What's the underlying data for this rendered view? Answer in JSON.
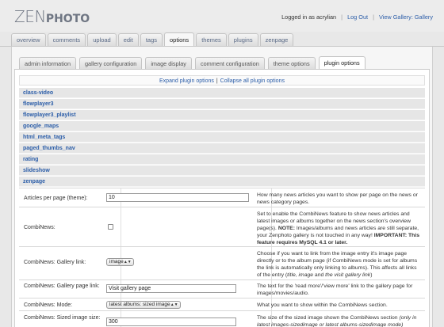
{
  "header": {
    "logo_part1": "ZEN",
    "logo_part2": "PHOTO",
    "logged_in": "Logged in as acrylian",
    "logout": "Log Out",
    "view_gallery": "View Gallery: Gallery"
  },
  "main_tabs": [
    "overview",
    "comments",
    "upload",
    "edit",
    "tags",
    "options",
    "themes",
    "plugins",
    "zenpage"
  ],
  "sub_tabs": [
    "admin information",
    "gallery configuration",
    "image display",
    "comment configuration",
    "theme options",
    "plugin options"
  ],
  "expand": {
    "expand_all": "Expand plugin options",
    "collapse_all": "Collapse all plugin options",
    "separator": "|"
  },
  "plugins": [
    "class-video",
    "flowplayer3",
    "flowplayer3_playlist",
    "google_maps",
    "html_meta_tags",
    "paged_thumbs_nav",
    "rating",
    "slideshow",
    "zenpage"
  ],
  "options": {
    "articles": {
      "label": "Articles per page (theme):",
      "value": "10",
      "desc": "How many news articles you want to show per page on the news or news category pages."
    },
    "combinews": {
      "label": "CombiNews:",
      "desc_a": "Set to enable the CombiNews feature to show news articles and latest images or albums together on the news section's overview page(s). ",
      "desc_note": "NOTE:",
      "desc_b": " Images/albums and news articles are still separate, your Zenphoto gallery is not touched in any way! ",
      "desc_important": "IMPORTANT: This feature requires MySQL 4.1 or later."
    },
    "gallery_link": {
      "label": "CombiNews: Gallery link:",
      "value": "image",
      "desc_a": "Choose if you want to link from the image entry it's image page directly or to the album page (if CombiNews mode is set for albums the link is automatically only linking to albums). This affects all links of the entry (",
      "desc_title": "title",
      "desc_comma": ", ",
      "desc_image": "image",
      "desc_and": " and ",
      "desc_visit": "the visit gallery link",
      "desc_end": ")"
    },
    "gallery_page_link": {
      "label": "CombiNews: Gallery page link:",
      "value": "Visit gallery page",
      "desc": "The text for the 'read more'/'view more' link to the gallery page for images/movies/audio."
    },
    "mode": {
      "label": "CombiNews: Mode:",
      "value": "latest albums: sized image",
      "desc": "What you want to show within the CombiNews section."
    },
    "sized_image": {
      "label": "CombiNews: Sized image size:",
      "value": "300",
      "desc_a": "The size of the sized image shown the CombiNews section ",
      "desc_i": "(only in latest images-sizedimage or latest albums-sizedimage mode)"
    }
  }
}
